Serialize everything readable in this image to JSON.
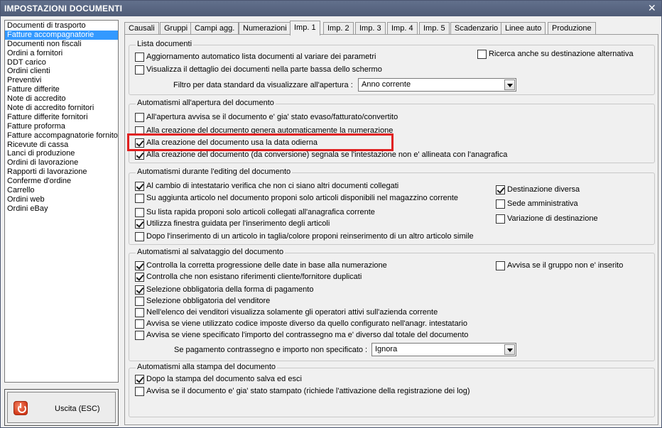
{
  "window": {
    "title": "IMPOSTAZIONI DOCUMENTI",
    "close_glyph": "✕"
  },
  "left_list": {
    "items": [
      "Documenti di trasporto",
      "Fatture accompagnatorie",
      "Documenti non fiscali",
      "Ordini a fornitori",
      "DDT carico",
      "Ordini clienti",
      "Preventivi",
      "Fatture differite",
      "Note di accredito",
      "Note di accredito fornitori",
      "Fatture differite fornitori",
      "Fatture proforma",
      "Fatture accompagnatorie fornito",
      "Ricevute di cassa",
      "Lanci di produzione",
      "Ordini di lavorazione",
      "Rapporti di lavorazione",
      "Conferme d'ordine",
      "Carrello",
      "Ordini web",
      "Ordini eBay"
    ],
    "selected_index": 1
  },
  "exit_button": {
    "label": "Uscita (ESC)",
    "icon": "power-icon"
  },
  "tabs": [
    "Causali",
    "Gruppi",
    "Campi agg.",
    "Numerazioni",
    "Imp. 1",
    "Imp. 2",
    "Imp. 3",
    "Imp. 4",
    "Imp. 5",
    "Scadenzario",
    "Linee auto",
    "Produzione"
  ],
  "active_tab": "Imp. 1",
  "groups": {
    "lista": {
      "title": "Lista documenti",
      "cb_aggiornamento": "Aggiornamento automatico lista documenti al variare dei parametri",
      "cb_ricerca": "Ricerca anche su destinazione alternativa",
      "cb_dettaglio": "Visualizza il dettaglio dei documenti nella parte bassa dello schermo",
      "filtro_label": "Filtro per data standard da visualizzare all'apertura :",
      "filtro_value": "Anno corrente"
    },
    "apertura": {
      "title": "Automatismi all'apertura del documento",
      "cb1": "All'apertura avvisa se il documento e' gia' stato evaso/fatturato/convertito",
      "cb2": "Alla creazione del documento genera automaticamente la numerazione",
      "cb3": "Alla creazione del documento usa la data odierna",
      "cb4": "Alla creazione del documento (da conversione) segnala se l'intestazione non e' allineata con l'anagrafica"
    },
    "editing": {
      "title": "Automatismi durante l'editing del documento",
      "cb1": "Al cambio di intestatario verifica che non ci siano altri documenti collegati",
      "cb2": "Su aggiunta articolo nel documento proponi solo articoli disponibili nel magazzino corrente",
      "cb3": "Su lista rapida proponi solo articoli collegati all'anagrafica corrente",
      "cb4": "Utilizza finestra guidata per l'inserimento degli articoli",
      "cb5": "Dopo l'inserimento di un articolo in taglia/colore proponi reinserimento di un altro articolo simile",
      "dest_diversa": "Destinazione diversa",
      "sede_amm": "Sede amministrativa",
      "var_dest": "Variazione di destinazione"
    },
    "salvataggio": {
      "title": "Automatismi al salvataggio del documento",
      "cb1": "Controlla la corretta progressione delle date in base alla numerazione",
      "cb_gruppo": "Avvisa se il gruppo non e' inserito",
      "cb2": "Controlla che non esistano riferimenti cliente/fornitore duplicati",
      "cb3": "Selezione obbligatoria della forma di pagamento",
      "cb4": "Selezione obbligatoria del venditore",
      "cb5": "Nell'elenco dei venditori visualizza solamente gli operatori attivi sull'azienda corrente",
      "cb6": "Avvisa se viene utilizzato codice imposte diverso da quello configurato nell'anagr. intestatario",
      "cb7": "Avvisa se viene specificato l'importo del contrassegno ma e' diverso dal totale del documento",
      "contr_label": "Se pagamento contrassegno e importo non specificato :",
      "contr_value": "Ignora"
    },
    "stampa": {
      "title": "Automatismi alla stampa del documento",
      "cb1": "Dopo la stampa del documento salva ed esci",
      "cb2": "Avvisa se il documento e' gia' stato stampato (richiede l'attivazione della registrazione dei log)"
    }
  },
  "checked": {
    "lista_aggiornamento": false,
    "lista_ricerca": false,
    "lista_dettaglio": false,
    "apertura_cb1": false,
    "apertura_cb2": false,
    "apertura_cb3": true,
    "apertura_cb4": true,
    "editing_cb1": true,
    "editing_cb2": false,
    "editing_cb3": false,
    "editing_cb4": true,
    "editing_cb5": false,
    "editing_dest_diversa": true,
    "editing_sede_amm": false,
    "editing_var_dest": false,
    "salv_cb1": true,
    "salv_gruppo": false,
    "salv_cb2": true,
    "salv_cb3": true,
    "salv_cb4": false,
    "salv_cb5": false,
    "salv_cb6": false,
    "salv_cb7": false,
    "stampa_cb1": true,
    "stampa_cb2": false
  },
  "colors": {
    "titlebar": "#566380",
    "selection": "#3399ff",
    "highlight": "#e02020"
  }
}
